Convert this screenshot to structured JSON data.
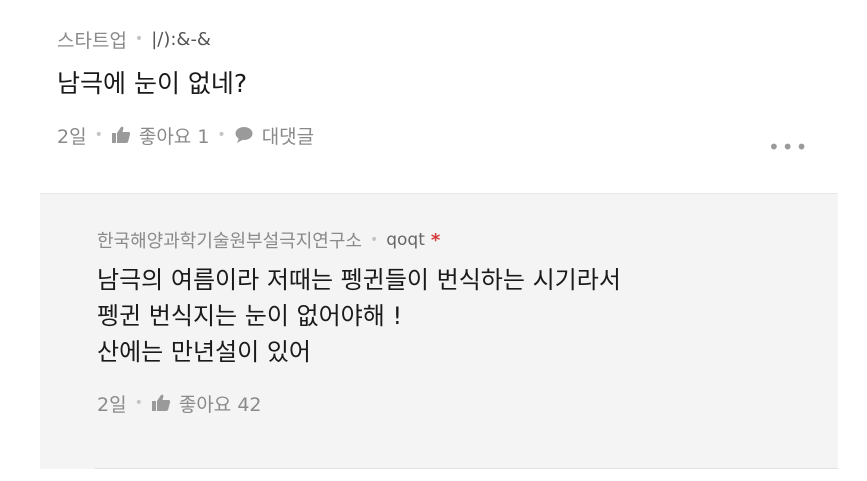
{
  "comment": {
    "board": "스타트업",
    "nickname": "|/):&-&",
    "text": "남극에 눈이 없네?",
    "time": "2일",
    "like_label": "좋아요 1",
    "reply_label": "대댓글",
    "more_label": "•••"
  },
  "reply": {
    "board": "한국해양과학기술원부설극지연구소",
    "nickname": "qoqt",
    "badge": "*",
    "lines": [
      "남극의 여름이라 저때는 펭귄들이 번식하는 시기라서",
      "펭귄 번식지는 눈이 없어야해 !",
      "산에는 만년설이 있어"
    ],
    "time": "2일",
    "like_label": "좋아요 42"
  },
  "colors": {
    "meta_text": "#8a8a8a",
    "body_text": "#1a1a1a",
    "reply_bg": "#f4f4f4",
    "badge": "#d53a3a"
  }
}
